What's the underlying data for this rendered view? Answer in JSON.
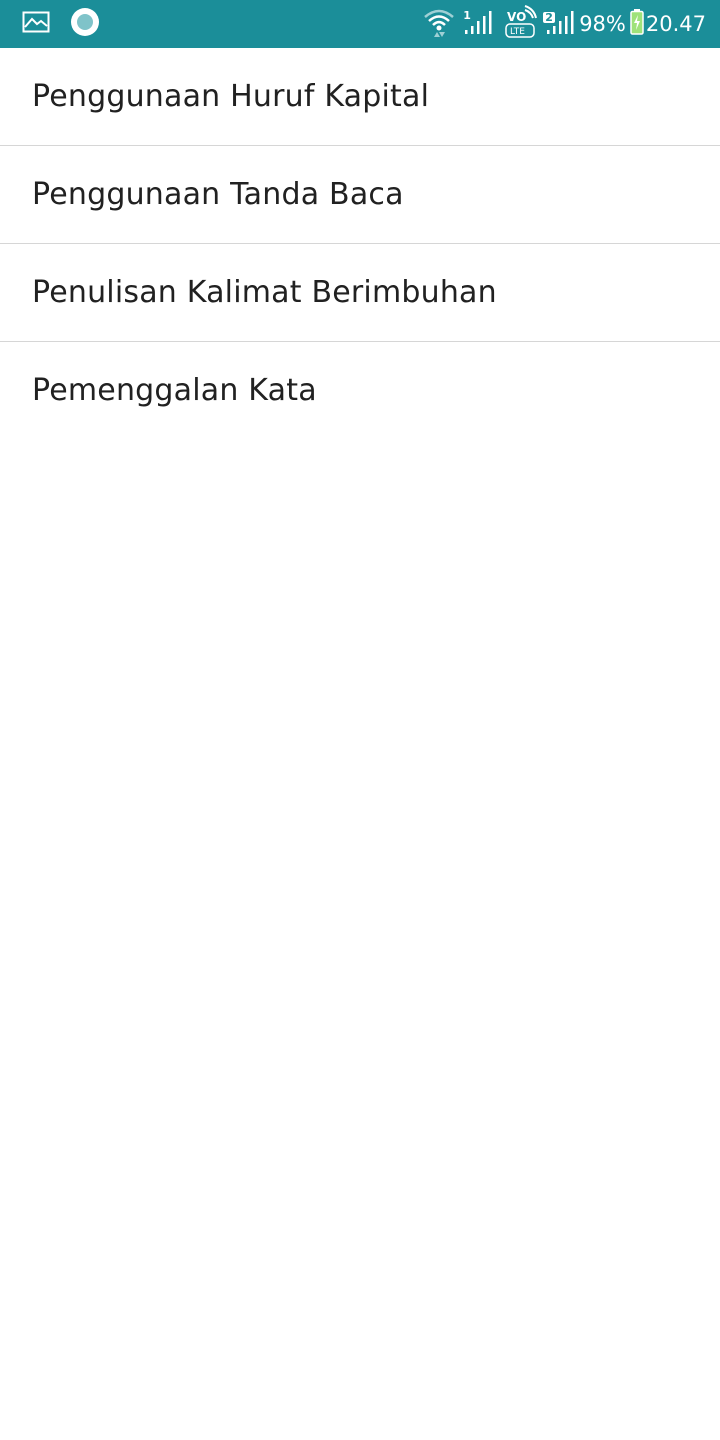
{
  "status_bar": {
    "background": "#1b8e99",
    "left_icons": [
      "image-notification-icon",
      "recording-circle-icon"
    ],
    "right_icons": [
      "wifi-icon",
      "signal-sim1-icon",
      "volte-icon",
      "signal-sim2-icon",
      "battery-charging-icon"
    ],
    "sim1_label": "1",
    "sim2_label": "2",
    "volte_top": "VO",
    "volte_bottom": "LTE",
    "battery_percent": "98%",
    "battery_level": 0.98,
    "time": "20.47"
  },
  "menu": {
    "items": [
      {
        "label": "Penggunaan Huruf Kapital"
      },
      {
        "label": "Penggunaan Tanda Baca"
      },
      {
        "label": "Penulisan Kalimat Berimbuhan"
      },
      {
        "label": "Pemenggalan Kata"
      }
    ]
  }
}
